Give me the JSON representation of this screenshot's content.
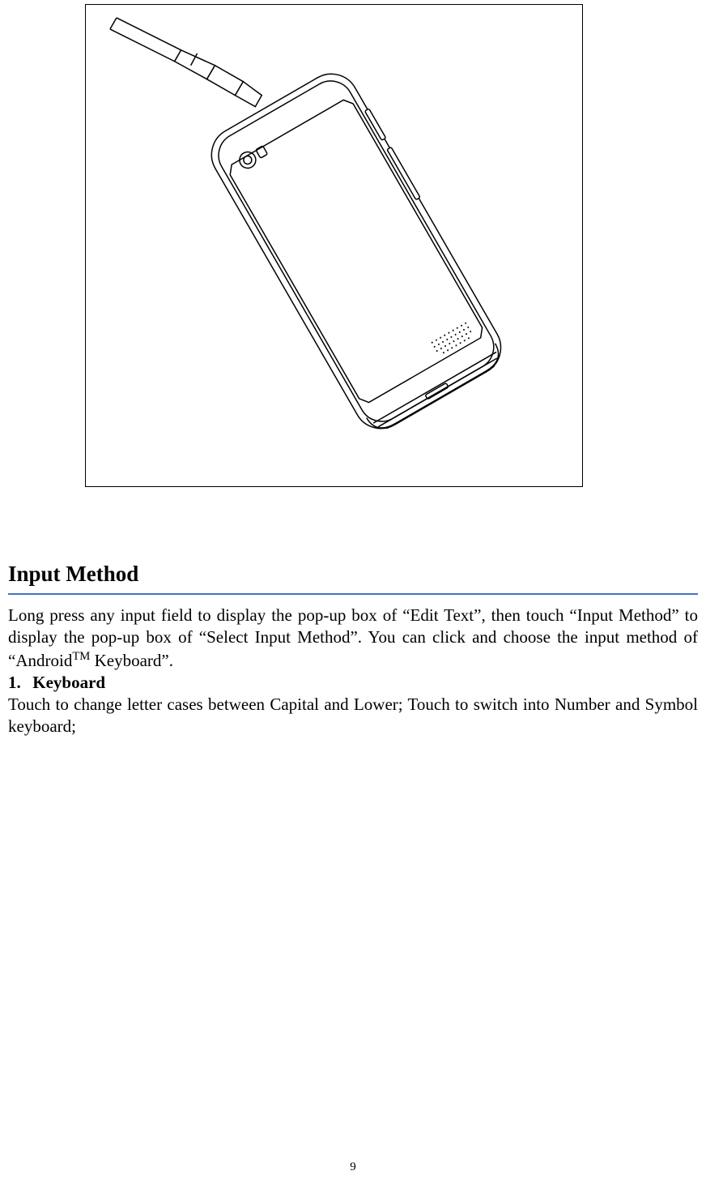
{
  "section": {
    "title": "Input Method",
    "paragraph1_a": "Long press any input field to display the pop-up box of “Edit Text”, then touch “Input Method” to display the pop-up box of “Select Input Method”. You can click and choose the input method of “Android",
    "tm": "TM",
    "paragraph1_b": " Keyboard”.",
    "item_number": "1.",
    "item_label": "Keyboard",
    "paragraph2": "Touch   to change letter cases between Capital and Lower; Touch   to switch into Number and Symbol keyboard;"
  },
  "page_number": "9"
}
